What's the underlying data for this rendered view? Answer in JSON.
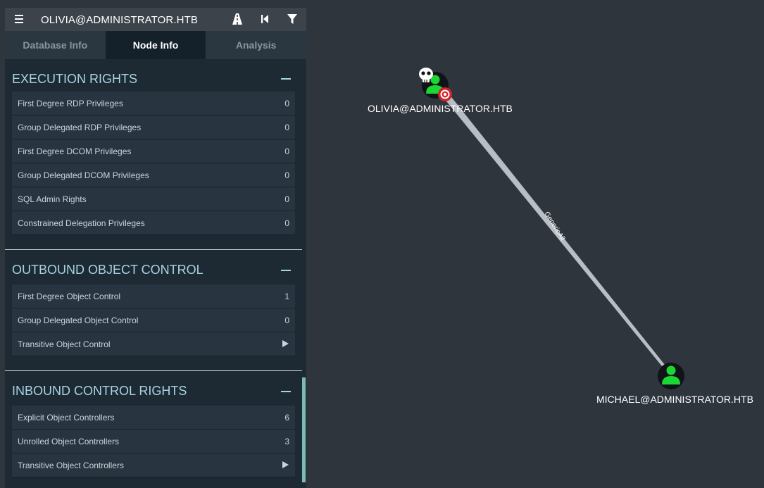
{
  "header": {
    "title": "OLIVIA@ADMINISTRATOR.HTB"
  },
  "toolbar_icons": [
    "menu-icon",
    "pathfinding-road-icon",
    "back-icon",
    "filter-icon"
  ],
  "tabs": [
    {
      "label": "Database Info",
      "active": false
    },
    {
      "label": "Node Info",
      "active": true
    },
    {
      "label": "Analysis",
      "active": false
    }
  ],
  "sections": [
    {
      "title": "EXECUTION RIGHTS",
      "rows": [
        {
          "label": "First Degree RDP Privileges",
          "value": "0"
        },
        {
          "label": "Group Delegated RDP Privileges",
          "value": "0"
        },
        {
          "label": "First Degree DCOM Privileges",
          "value": "0"
        },
        {
          "label": "Group Delegated DCOM Privileges",
          "value": "0"
        },
        {
          "label": "SQL Admin Rights",
          "value": "0"
        },
        {
          "label": "Constrained Delegation Privileges",
          "value": "0"
        }
      ]
    },
    {
      "title": "OUTBOUND OBJECT CONTROL",
      "rows": [
        {
          "label": "First Degree Object Control",
          "value": "1"
        },
        {
          "label": "Group Delegated Object Control",
          "value": "0"
        },
        {
          "label": "Transitive Object Control",
          "value": ""
        }
      ]
    },
    {
      "title": "INBOUND CONTROL RIGHTS",
      "rows": [
        {
          "label": "Explicit Object Controllers",
          "value": "6"
        },
        {
          "label": "Unrolled Object Controllers",
          "value": "3"
        },
        {
          "label": "Transitive Object Controllers",
          "value": ""
        }
      ]
    }
  ],
  "graph": {
    "nodes": [
      {
        "label": "OLIVIA@ADMINISTRATOR.HTB",
        "icon": "user-icon",
        "badges": [
          "skull-icon",
          "target-icon"
        ]
      },
      {
        "label": "MICHAEL@ADMINISTRATOR.HTB",
        "icon": "user-icon"
      }
    ],
    "edge": {
      "label": "GenericAll"
    }
  },
  "colors": {
    "background": "#2f353d",
    "panel": "#1d2a33",
    "section_title": "#a8d3e2",
    "user_green": "#1bd733",
    "scrollbar": "#7fb9b5"
  }
}
